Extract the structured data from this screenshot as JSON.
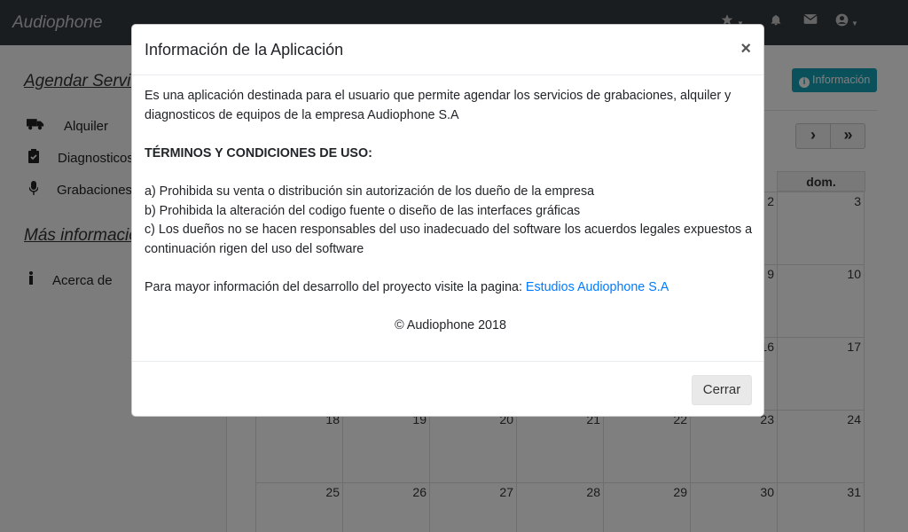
{
  "navbar": {
    "brand": "Audiophone",
    "icons": [
      "star-icon",
      "bell-icon",
      "envelope-icon",
      "user-circle-icon"
    ]
  },
  "sidebar": {
    "section1": "Agendar Servicios",
    "items": [
      {
        "label": "Alquiler",
        "icon": "truck-icon"
      },
      {
        "label": "Diagnosticos",
        "icon": "clipboard-check-icon"
      },
      {
        "label": "Grabaciones",
        "icon": "microphone-icon"
      }
    ],
    "section2": "Más información",
    "items2": [
      {
        "label": "Acerca de",
        "icon": "info-icon"
      }
    ]
  },
  "main": {
    "info_button": "Información",
    "next": "›",
    "last": "»"
  },
  "calendar": {
    "visible_header": "dom.",
    "rows": [
      [
        "",
        "",
        "",
        "",
        "",
        "2",
        "3"
      ],
      [
        "",
        "",
        "",
        "",
        "",
        "9",
        "10"
      ],
      [
        "",
        "",
        "",
        "",
        "",
        "16",
        "17"
      ],
      [
        "18",
        "19",
        "20",
        "21",
        "22",
        "23",
        "24"
      ],
      [
        "25",
        "26",
        "27",
        "28",
        "29",
        "30",
        "31"
      ]
    ]
  },
  "modal": {
    "title": "Información de la Aplicación",
    "close_symbol": "×",
    "intro": "Es una aplicación destinada para el usuario que permite agendar los servicios de grabaciones, alquiler y diagnosticos de equipos de la empresa Audiophone S.A",
    "terms_heading": "TÉRMINOS Y CONDICIONES DE USO:",
    "terms": [
      "a) Prohibida su venta o distribución sin autorización de los dueño de la empresa",
      "b) Prohibida la alteración del codigo fuente o diseño de las interfaces gráficas",
      "c) Los dueños no se hacen responsables del uso inadecuado del software los acuerdos legales expuestos a continuación rigen del uso del software"
    ],
    "more_info_text": "Para mayor información del desarrollo del proyecto visite la pagina: ",
    "more_info_link": "Estudios Audiophone S.A",
    "copyright": "© Audiophone 2018",
    "close_button": "Cerrar"
  },
  "colors": {
    "navbar": "#343a40",
    "info": "#17a2b8",
    "link": "#007bff"
  }
}
